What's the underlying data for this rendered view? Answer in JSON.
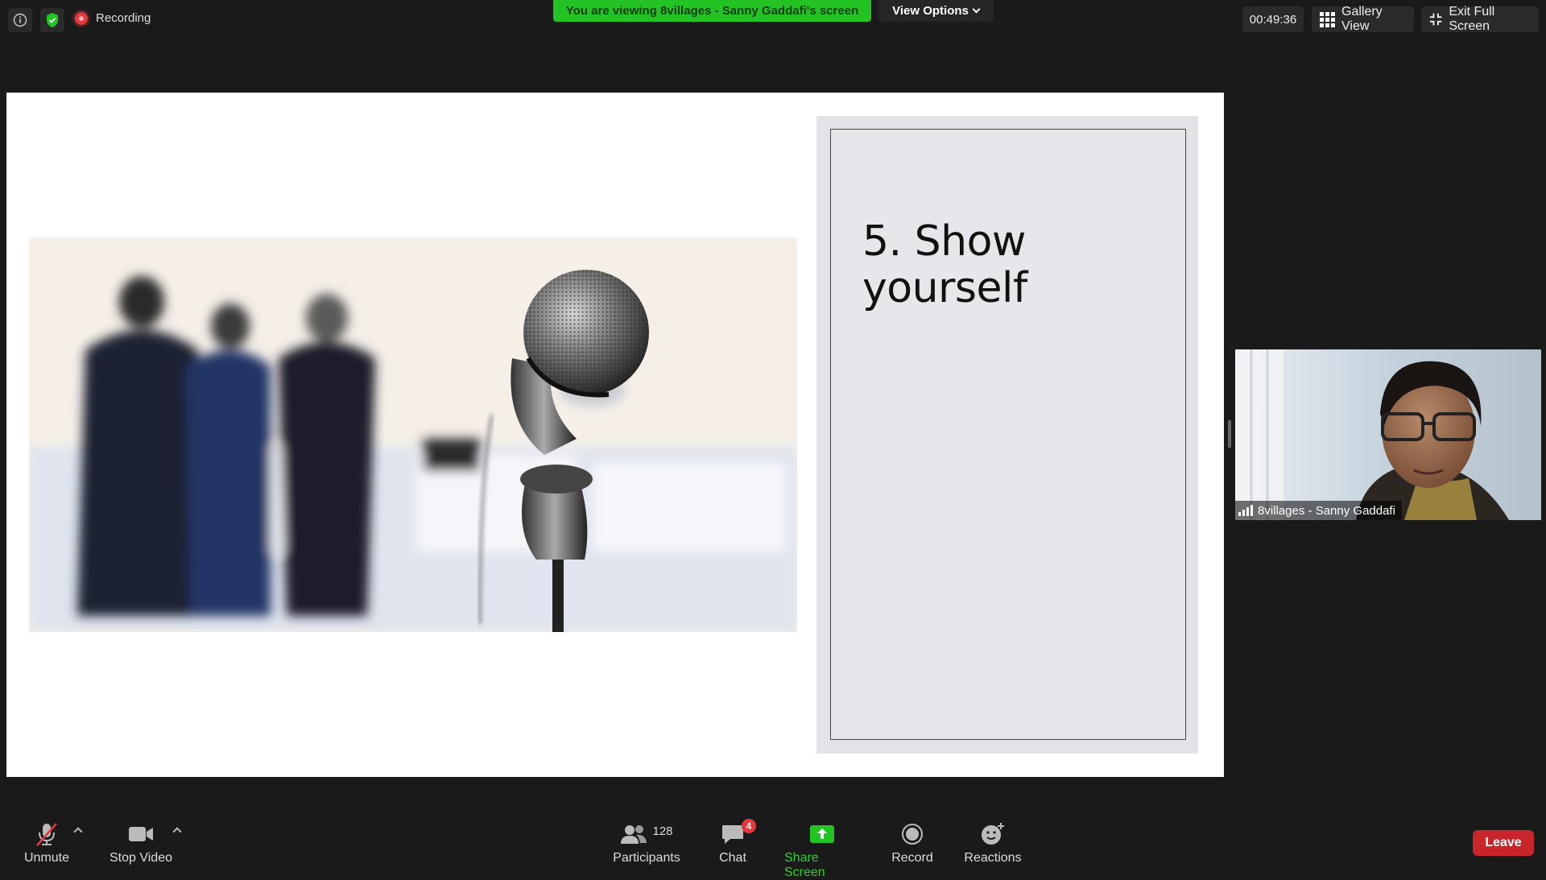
{
  "top_bar": {
    "recording_label": "Recording",
    "viewing_banner": "You are viewing 8villages - Sanny Gaddafi's screen",
    "view_options_label": "View Options",
    "timer": "00:49:36",
    "gallery_view_label": "Gallery View",
    "exit_full_screen_label": "Exit Full Screen",
    "icons": [
      "info-icon",
      "shield-check-icon",
      "recording-icon",
      "grid-icon",
      "exit-fullscreen-icon"
    ]
  },
  "shared_slide": {
    "title": "5. Show yourself",
    "image": "microphone-and-blurred-audience-photo"
  },
  "participant_tile": {
    "name": "8villages - Sanny Gaddafi"
  },
  "toolbar": {
    "unmute_label": "Unmute",
    "stop_video_label": "Stop Video",
    "participants_label": "Participants",
    "participants_count": "128",
    "chat_label": "Chat",
    "chat_badge": "4",
    "share_screen_label": "Share Screen",
    "record_label": "Record",
    "reactions_label": "Reactions",
    "leave_label": "Leave"
  },
  "colors": {
    "background": "#1a1a1a",
    "banner_green": "#23c323",
    "share_green": "#23c323",
    "leave_red": "#c8262b",
    "recording_red": "#e0393e"
  }
}
